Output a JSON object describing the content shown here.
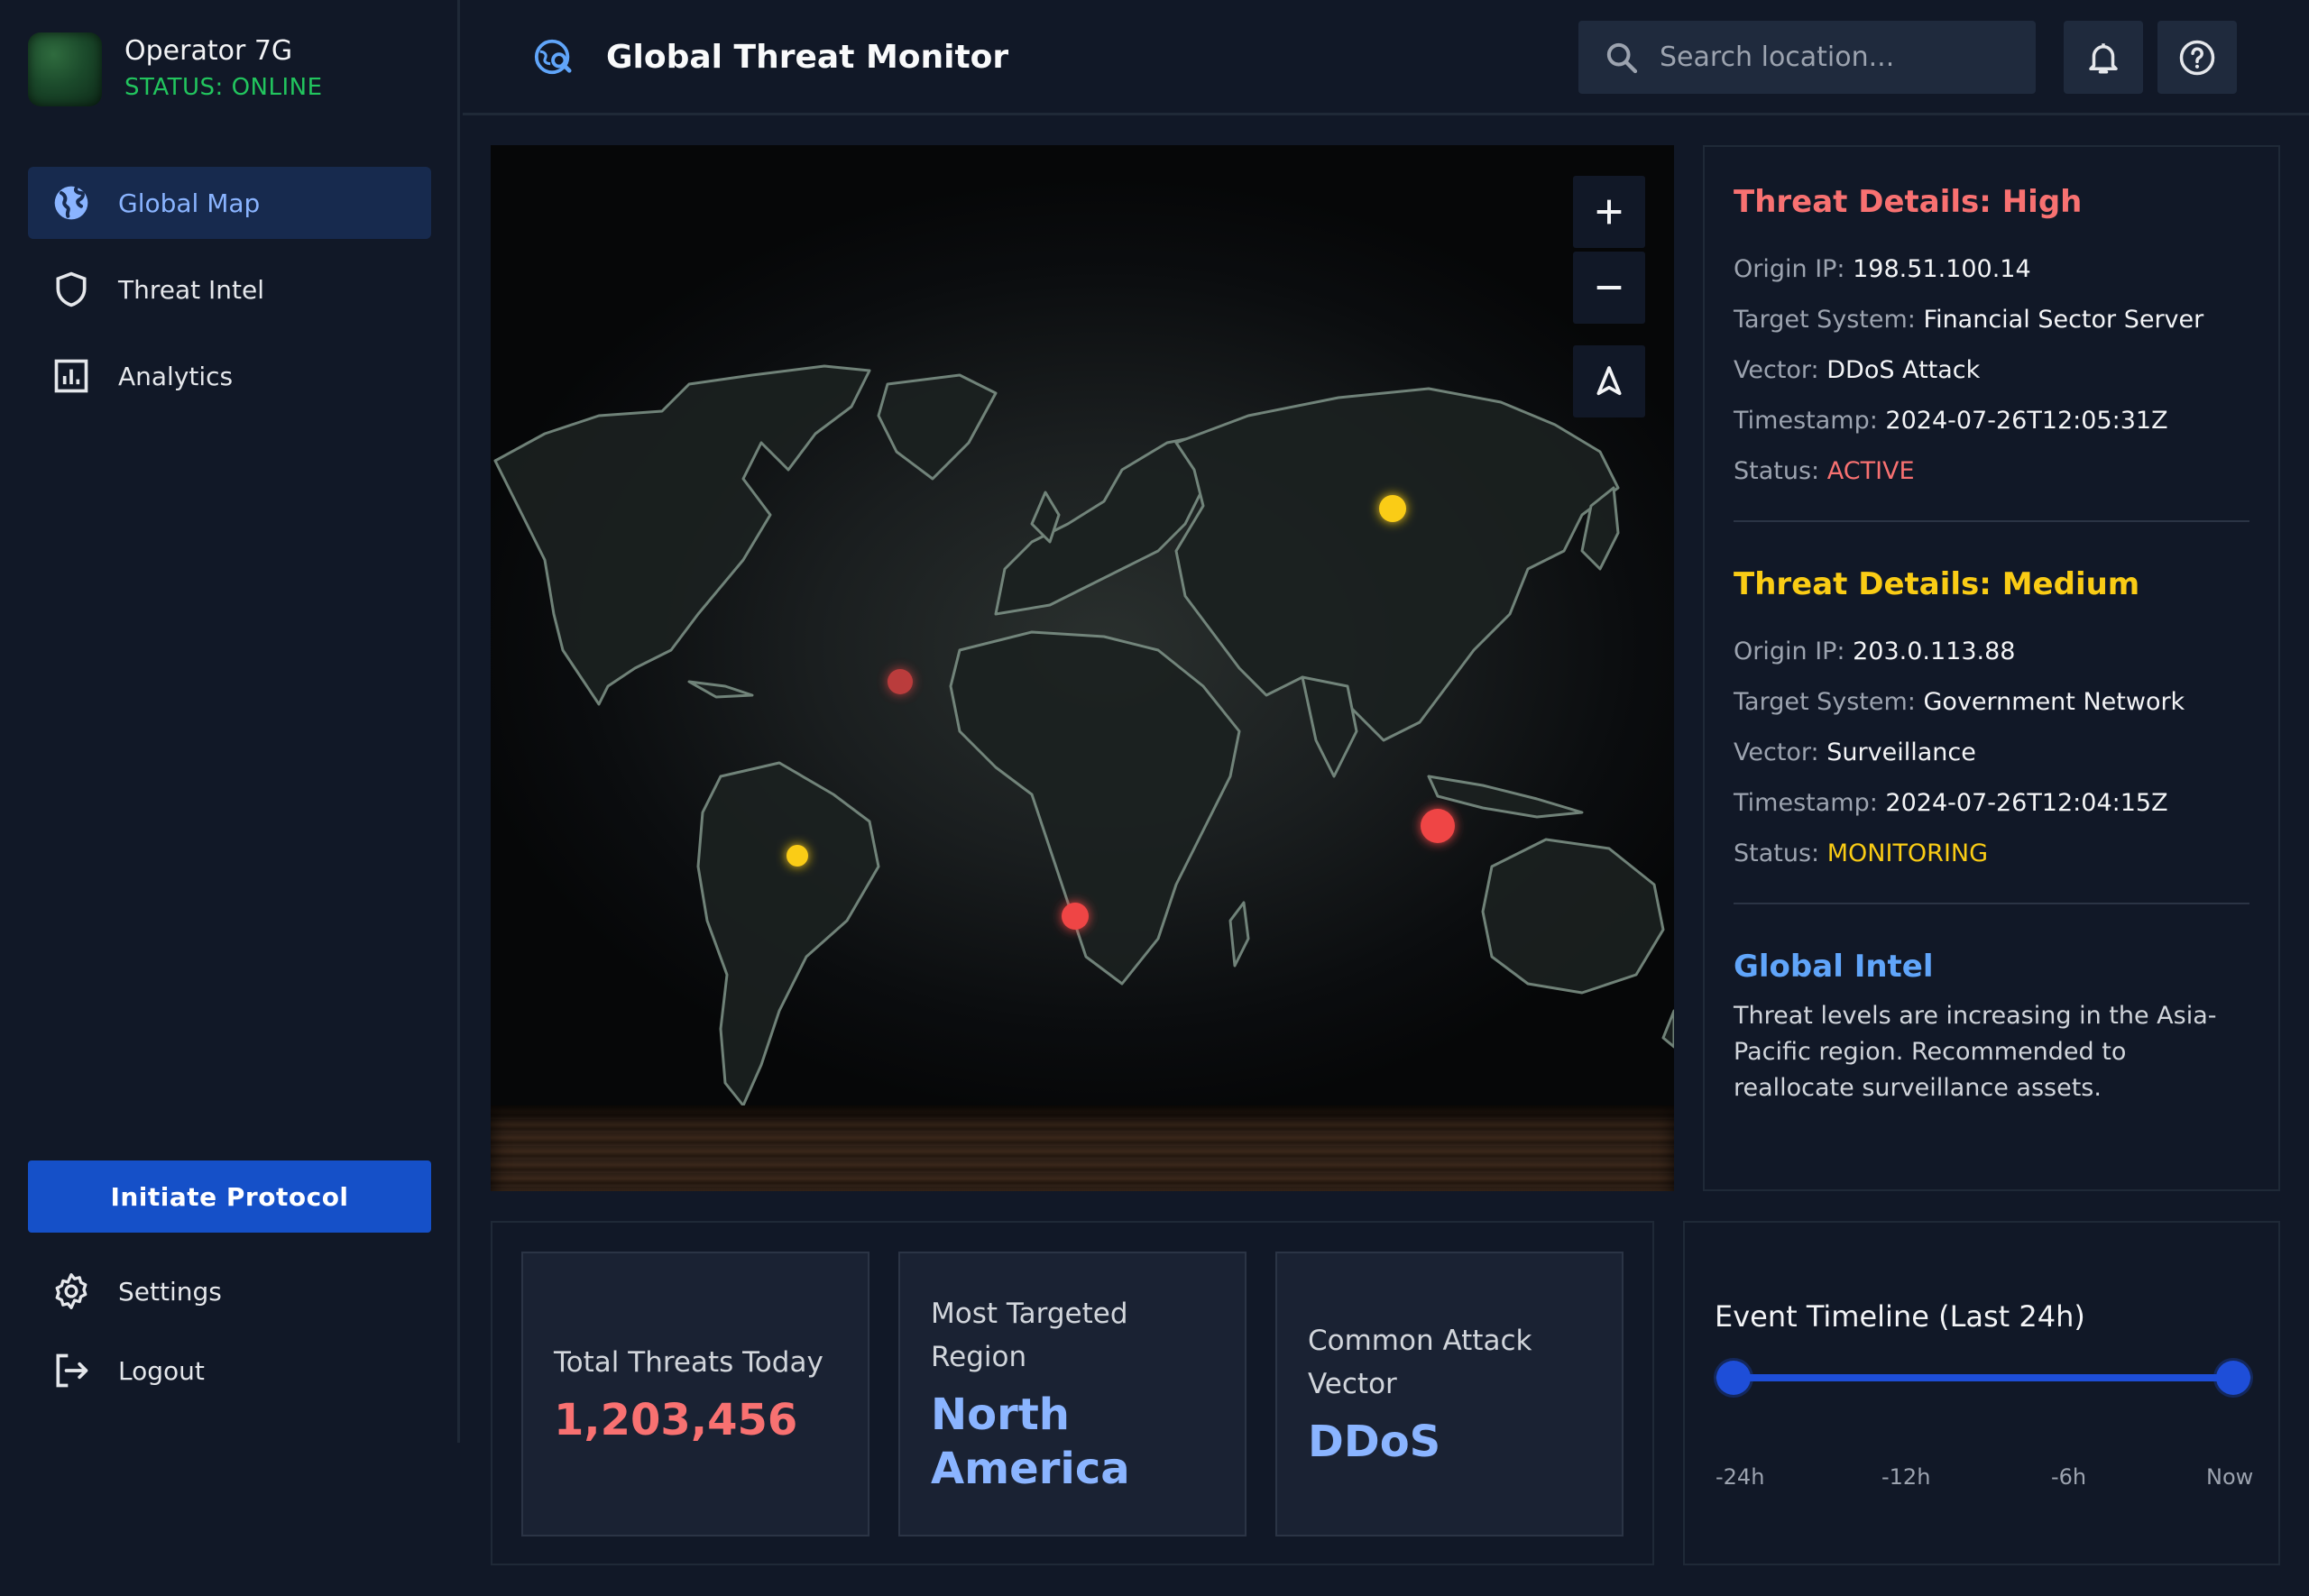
{
  "profile": {
    "name": "Operator 7G",
    "status": "STATUS: ONLINE"
  },
  "sidebar": {
    "items": [
      {
        "label": "Global Map",
        "icon": "globe-icon",
        "active": true
      },
      {
        "label": "Threat Intel",
        "icon": "shield-icon",
        "active": false
      },
      {
        "label": "Analytics",
        "icon": "chart-icon",
        "active": false
      }
    ],
    "protocol_button": "Initiate Protocol",
    "bottom_items": [
      {
        "label": "Settings",
        "icon": "gear-icon"
      },
      {
        "label": "Logout",
        "icon": "logout-icon"
      }
    ]
  },
  "header": {
    "title": "Global Threat Monitor",
    "search_placeholder": "Search location...",
    "icons": [
      "notifications-bell-icon",
      "help-icon"
    ]
  },
  "map": {
    "controls": [
      "zoom-in-icon",
      "zoom-out-icon",
      "locate-arrow-icon"
    ],
    "markers": [
      {
        "level": "high",
        "color": "#ef4444"
      },
      {
        "level": "high",
        "color": "#ef4444"
      },
      {
        "level": "high",
        "color": "#ef4444"
      },
      {
        "level": "medium",
        "color": "#facc15"
      },
      {
        "level": "medium",
        "color": "#facc15"
      }
    ]
  },
  "details": {
    "high": {
      "title": "Threat Details: High",
      "origin_ip_label": "Origin IP:",
      "origin_ip": "198.51.100.14",
      "target_label": "Target System:",
      "target": "Financial Sector Server",
      "vector_label": "Vector:",
      "vector": "DDoS Attack",
      "timestamp_label": "Timestamp:",
      "timestamp": "2024-07-26T12:05:31Z",
      "status_label": "Status:",
      "status": "ACTIVE"
    },
    "medium": {
      "title": "Threat Details: Medium",
      "origin_ip_label": "Origin IP:",
      "origin_ip": "203.0.113.88",
      "target_label": "Target System:",
      "target": "Government Network",
      "vector_label": "Vector:",
      "vector": "Surveillance",
      "timestamp_label": "Timestamp:",
      "timestamp": "2024-07-26T12:04:15Z",
      "status_label": "Status:",
      "status": "MONITORING"
    },
    "intel": {
      "title": "Global Intel",
      "text": "Threat levels are increasing in the Asia-Pacific region. Recommended to reallocate surveillance assets."
    }
  },
  "stats": {
    "total": {
      "label": "Total Threats Today",
      "value": "1,203,456"
    },
    "region": {
      "label": "Most Targeted Region",
      "value": "North America"
    },
    "vector": {
      "label": "Common Attack Vector",
      "value": "DDoS"
    }
  },
  "timeline": {
    "title": "Event Timeline (Last 24h)",
    "ticks": [
      "-24h",
      "-12h",
      "-6h",
      "Now"
    ],
    "range_start": 0.02,
    "range_end": 0.98
  },
  "colors": {
    "accent": "#1550c8",
    "high": "#f87171",
    "medium": "#facc15",
    "online": "#22c55e"
  }
}
